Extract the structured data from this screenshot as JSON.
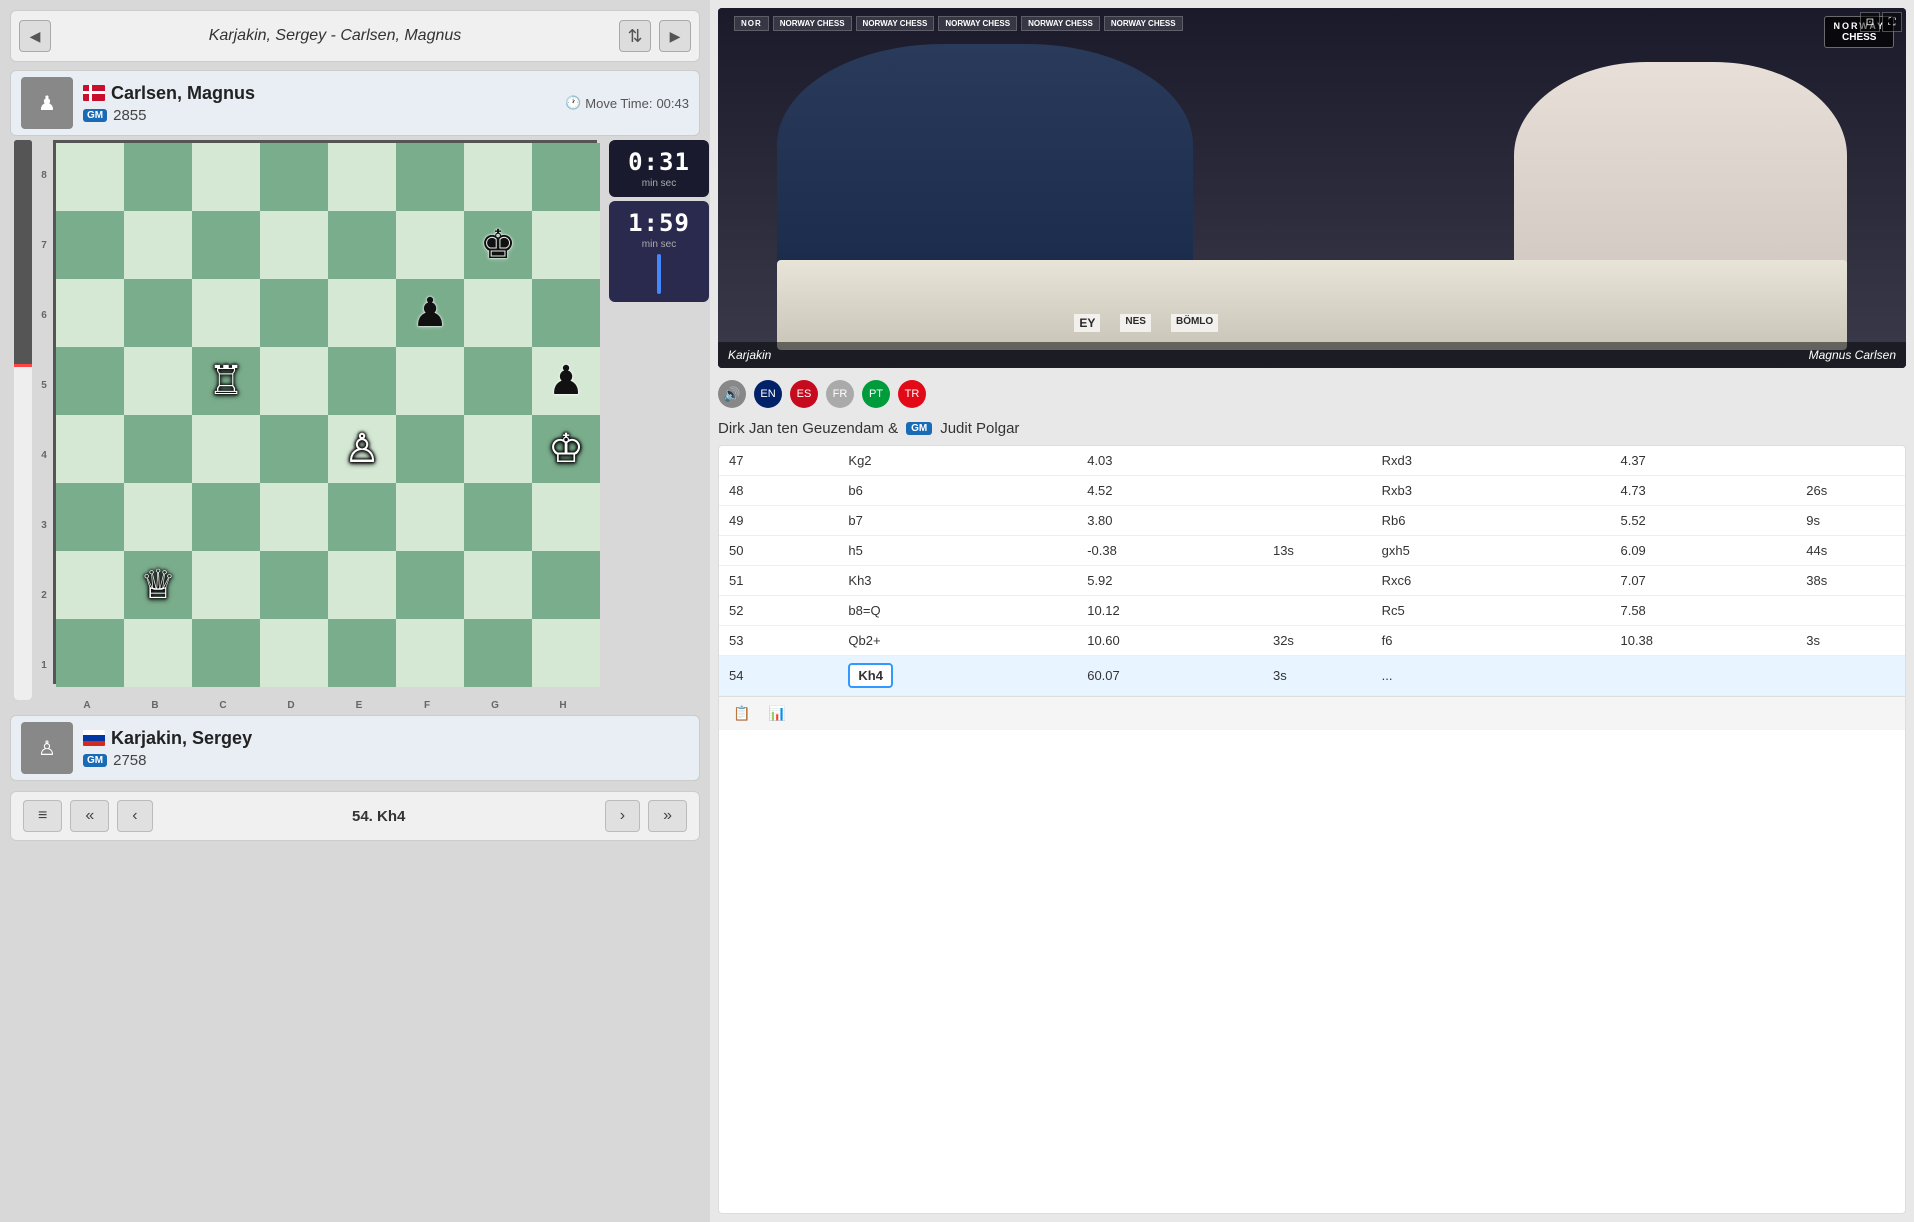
{
  "header": {
    "prev_btn": "◀",
    "next_btn": "▶",
    "game_title": "Karjakin, Sergey - Carlsen, Magnus",
    "swap_btn": "⇅"
  },
  "players": {
    "top": {
      "name": "Carlsen, Magnus",
      "flag": "dk",
      "title": "GM",
      "rating": "2855",
      "move_time_label": "Move Time:",
      "move_time": "00:43",
      "clock": "0:31",
      "clock_unit": "min   sec"
    },
    "bottom": {
      "name": "Karjakin, Sergey",
      "flag": "ru",
      "title": "GM",
      "rating": "2758",
      "clock": "1:59",
      "clock_unit": "min   sec"
    }
  },
  "board": {
    "ranks": [
      "8",
      "7",
      "6",
      "5",
      "4",
      "3",
      "2",
      "1"
    ],
    "files": [
      "A",
      "B",
      "C",
      "D",
      "E",
      "F",
      "G",
      "H"
    ]
  },
  "current_move": "54. Kh4",
  "controls": {
    "menu": "≡",
    "first": "«",
    "prev": "‹",
    "next": "›",
    "last": "»"
  },
  "video": {
    "sponsors": [
      "NORWAY CHESS",
      "NORWAY CHESS",
      "NORWAY CHESS",
      "NORWAY CHESS",
      "NORWAY CHESS"
    ],
    "player_left_label": "Karjakin",
    "player_right_label": "Magnus Carlsen",
    "norway_chess_line1": "NORWAY",
    "norway_chess_line2": "CHESS"
  },
  "broadcast": {
    "languages": [
      "🔊",
      "🇬🇧",
      "🇪🇸",
      "🇫🇷",
      "🇧🇷",
      "🇹🇷"
    ]
  },
  "commentators": {
    "text": "Dirk Jan ten Geuzendam &",
    "title": "GM",
    "name": "Judit Polgar"
  },
  "moves": [
    {
      "num": 47,
      "white": "Kg2",
      "white_time": "4.03",
      "white_clock": "",
      "black": "Rxd3",
      "black_time": "4.37",
      "black_clock": ""
    },
    {
      "num": 48,
      "white": "b6",
      "white_time": "4.52",
      "white_clock": "",
      "black": "Rxb3",
      "black_time": "4.73",
      "black_clock": "26s"
    },
    {
      "num": 49,
      "white": "b7",
      "white_time": "3.80",
      "white_clock": "",
      "black": "Rb6",
      "black_time": "5.52",
      "black_clock": "9s"
    },
    {
      "num": 50,
      "white": "h5",
      "white_time": "-0.38",
      "white_clock": "13s",
      "black": "gxh5",
      "black_time": "6.09",
      "black_clock": "44s"
    },
    {
      "num": 51,
      "white": "Kh3",
      "white_time": "5.92",
      "white_clock": "",
      "black": "Rxc6",
      "black_time": "7.07",
      "black_clock": "38s"
    },
    {
      "num": 52,
      "white": "b8=Q",
      "white_time": "10.12",
      "white_clock": "",
      "black": "Rc5",
      "black_time": "7.58",
      "black_clock": ""
    },
    {
      "num": 53,
      "white": "Qb2+",
      "white_time": "10.60",
      "white_clock": "32s",
      "black": "f6",
      "black_time": "10.38",
      "black_clock": "3s"
    },
    {
      "num": 54,
      "white": "Kh4",
      "white_time": "60.07",
      "white_clock": "3s",
      "black": "...",
      "black_time": "",
      "black_clock": "",
      "active": true
    }
  ]
}
